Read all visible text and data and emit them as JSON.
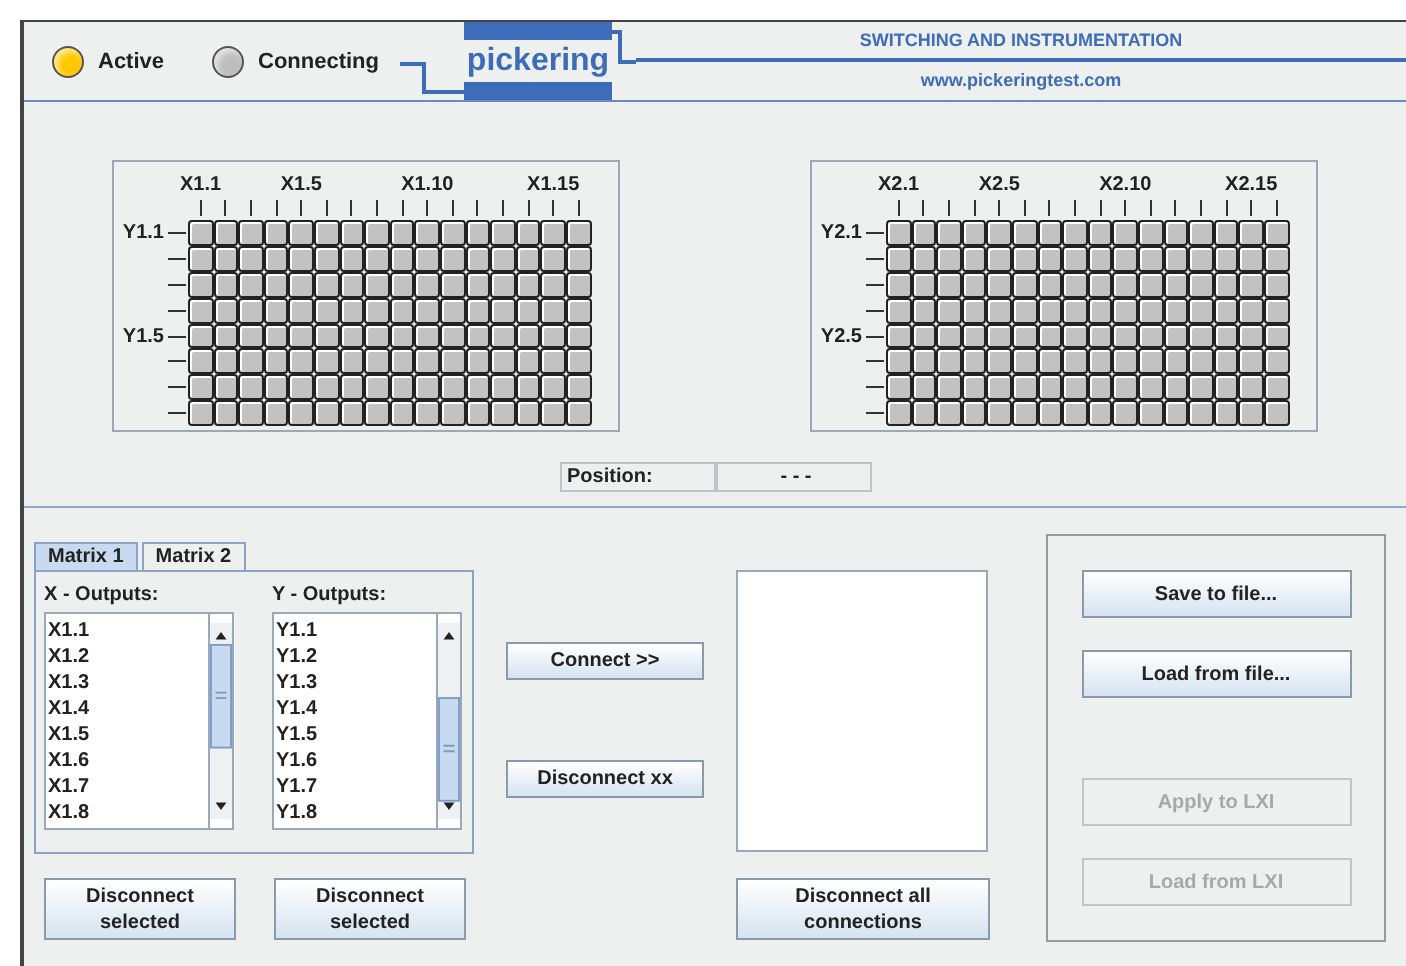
{
  "header": {
    "indicators": [
      {
        "label": "Active",
        "color": "#ffc800"
      },
      {
        "label": "Connecting",
        "color": "#bdbdbd"
      }
    ],
    "logo": "pickering",
    "tagline": "SWITCHING AND INSTRUMENTATION",
    "url": "www.pickeringtest.com"
  },
  "matrices": [
    {
      "columns": [
        {
          "label": "X1.1"
        },
        {},
        {},
        {},
        {
          "label": "X1.5"
        },
        {},
        {},
        {},
        {},
        {
          "label": "X1.10"
        },
        {},
        {},
        {},
        {},
        {
          "label": "X1.15"
        },
        {}
      ],
      "rows": [
        {
          "label": "Y1.1"
        },
        {},
        {},
        {},
        {
          "label": "Y1.5"
        },
        {},
        {},
        {}
      ]
    },
    {
      "columns": [
        {
          "label": "X2.1"
        },
        {},
        {},
        {},
        {
          "label": "X2.5"
        },
        {},
        {},
        {},
        {},
        {
          "label": "X2.10"
        },
        {},
        {},
        {},
        {},
        {
          "label": "X2.15"
        },
        {}
      ],
      "rows": [
        {
          "label": "Y2.1"
        },
        {},
        {},
        {},
        {
          "label": "Y2.5"
        },
        {},
        {},
        {}
      ]
    }
  ],
  "position": {
    "label": "Position:",
    "value": "- - -"
  },
  "tabs": [
    {
      "label": "Matrix 1",
      "selected": true
    },
    {
      "label": "Matrix 2",
      "selected": false
    }
  ],
  "x_outputs": {
    "heading": "X - Outputs:",
    "items": [
      "X1.1",
      "X1.2",
      "X1.3",
      "X1.4",
      "X1.5",
      "X1.6",
      "X1.7",
      "X1.8"
    ]
  },
  "y_outputs": {
    "heading": "Y - Outputs:",
    "items": [
      "Y1.1",
      "Y1.2",
      "Y1.3",
      "Y1.4",
      "Y1.5",
      "Y1.6",
      "Y1.7",
      "Y1.8"
    ]
  },
  "disconnect_selected": [
    "Disconnect selected",
    "Disconnect selected"
  ],
  "actions": {
    "connect": "Connect   >>",
    "disconnect": "Disconnect   xx"
  },
  "disconnect_all": "Disconnect all connections",
  "file_buttons": [
    {
      "label": "Save to file...",
      "disabled": false
    },
    {
      "label": "Load from file...",
      "disabled": false
    },
    {
      "label": "Apply to LXI",
      "disabled": true
    },
    {
      "label": "Load from LXI",
      "disabled": true
    }
  ]
}
